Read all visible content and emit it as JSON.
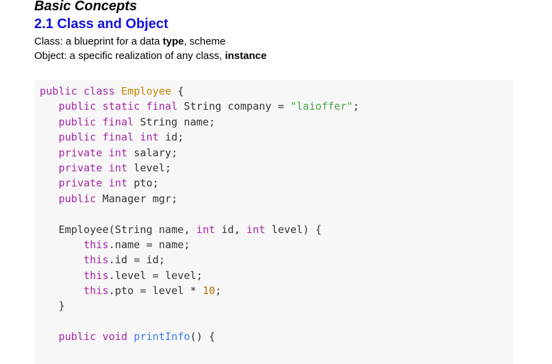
{
  "heading": {
    "title": "Basic Concepts",
    "subtitle": "2.1 Class and Object"
  },
  "definitions": {
    "class_prefix": "Class: a blueprint for a data ",
    "class_bold": "type",
    "class_suffix": ", scheme",
    "object_prefix": "Object: a specific realization of any class, ",
    "object_bold": "instance"
  },
  "code": {
    "language": "java",
    "lines": [
      "public class Employee {",
      "   public static final String company = \"laioffer\";",
      "   public final String name;",
      "   public final int id;",
      "   private int salary;",
      "   private int level;",
      "   private int pto;",
      "   public Manager mgr;",
      "",
      "   Employee(String name, int id, int level) {",
      "       this.name = name;",
      "       this.id = id;",
      "       this.level = level;",
      "       this.pto = level * 10;",
      "   }",
      "",
      "   public void printInfo() {"
    ]
  }
}
